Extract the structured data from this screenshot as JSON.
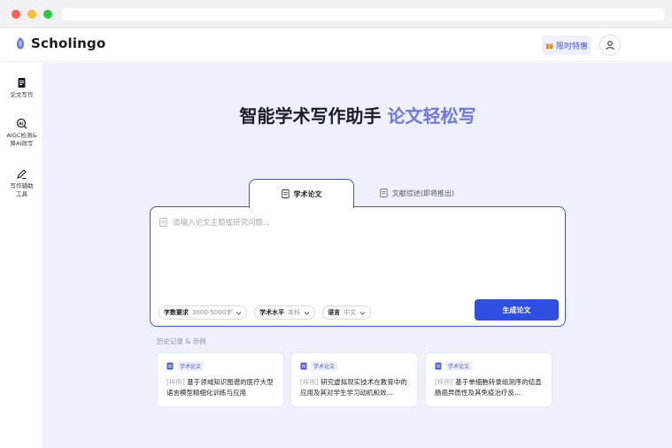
{
  "app": {
    "name": "Scholingo",
    "promo_label": "限时特惠"
  },
  "sidebar": {
    "items": [
      {
        "label": "论文写作",
        "icon": "document-icon"
      },
      {
        "label": "AIGC检测&\n降AI改写",
        "icon": "ai-detect-icon"
      },
      {
        "label": "写作辅助\n工具",
        "icon": "pen-icon"
      }
    ]
  },
  "hero": {
    "title": "智能学术写作助手 ",
    "accent": "论文轻松写"
  },
  "tabs": [
    {
      "label": "学术论文",
      "active": true
    },
    {
      "label": "文献综述(即将推出)",
      "active": false
    }
  ],
  "editor": {
    "placeholder": "请输入论文主题或研究问题...",
    "controls": [
      {
        "key": "字数要求",
        "value": "3000-5000字"
      },
      {
        "key": "学术水平",
        "value": "本科"
      },
      {
        "key": "语言",
        "value": "中文"
      }
    ],
    "generate_label": "生成论文"
  },
  "history": {
    "title": "历史记录 & 示例",
    "cards": [
      {
        "tag": "学术论文",
        "prefix": "[样例]",
        "title": " 基于领域知识图谱的医疗大型语言模型精细化训练与应用"
      },
      {
        "tag": "学术论文",
        "prefix": "[样例]",
        "title": " 研究虚拟现实技术在教育中的应用及其对学生学习动机和效..."
      },
      {
        "tag": "学术论文",
        "prefix": "[样例]",
        "title": " 基于单细胞转录组测序的结直肠癌异质性及其免疫治疗反..."
      }
    ]
  },
  "colors": {
    "accent": "#3f57cf",
    "button": "#2f4fe0",
    "hero_accent": "#6b78e5",
    "background": "#eef0fb"
  }
}
